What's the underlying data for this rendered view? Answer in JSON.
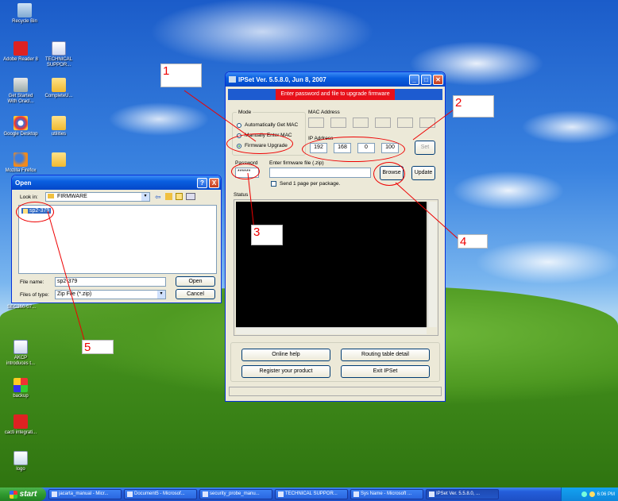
{
  "desktop_icons": [
    {
      "id": "recycle",
      "label": "Recycle Bin",
      "icon": "recycle-bin-icon"
    },
    {
      "id": "adobe",
      "label": "Adobe Reader 8",
      "icon": "pdf-icon"
    },
    {
      "id": "technical",
      "label": "TECHNICAL SUPPOR...",
      "icon": "word-doc-icon"
    },
    {
      "id": "oracle",
      "label": "Get Started With Oracl...",
      "icon": "database-icon"
    },
    {
      "id": "complete",
      "label": "CompleteU...",
      "icon": "folder-icon"
    },
    {
      "id": "google",
      "label": "Google Desktop",
      "icon": "google-desktop-icon"
    },
    {
      "id": "utilities",
      "label": "utilities",
      "icon": "folder-icon"
    },
    {
      "id": "firefox",
      "label": "Mozilla Firefox",
      "icon": "firefox-icon"
    },
    {
      "id": "folder2",
      "label": "",
      "icon": "folder-icon"
    },
    {
      "id": "sec",
      "label": "SEC360-07...",
      "icon": "folder-icon"
    },
    {
      "id": "akcp",
      "label": "AKCP introduces t...",
      "icon": "word-doc-icon"
    },
    {
      "id": "backup",
      "label": "backup",
      "icon": "backup-icon"
    },
    {
      "id": "cacti",
      "label": "cacti integrati...",
      "icon": "pdf-icon"
    },
    {
      "id": "logo",
      "label": "logo",
      "icon": "image-icon"
    }
  ],
  "callouts": [
    "1",
    "2",
    "3",
    "4",
    "5"
  ],
  "open_dialog": {
    "title": "Open",
    "look_in_label": "Look in:",
    "look_in_value": "FIRMWARE",
    "files": [
      "sp2-379"
    ],
    "file_name_label": "File name:",
    "file_name_value": "sp2-379",
    "files_of_type_label": "Files of type:",
    "files_of_type_value": "Zip File (*.zip)",
    "open_button": "Open",
    "cancel_button": "Cancel",
    "help_button": "?",
    "close_button": "X"
  },
  "ipset": {
    "title": "IPSet  Ver. 5.5.8.0,  Jun 8, 2007",
    "banner": "Enter password and file to upgrade firmware",
    "mode_label": "Mode",
    "mode_options": [
      "Automatically Get MAC",
      "Manually Enter MAC",
      "Firmware Upgrade"
    ],
    "mode_selected": "Firmware Upgrade",
    "mac_label": "MAC Address",
    "ip_label": "IP Address",
    "ip_octets": [
      "192",
      "168",
      "0",
      "100"
    ],
    "set_button": "Set",
    "password_label": "Password",
    "password_value": "******",
    "firmware_label": "Enter firmware file (.zip)",
    "firmware_value": "",
    "browse_button": "Browse",
    "update_button": "Update",
    "send_one_label": "Send 1 page per package.",
    "status_label": "Status",
    "online_help": "Online help",
    "routing_table": "Routing table detail",
    "register": "Register your product",
    "exit": "Exit IPSet"
  },
  "taskbar": {
    "start": "start",
    "tasks": [
      "jacarta_manual - Micr...",
      "Document5 - Microsof...",
      "security_probe_manu...",
      "TECHNICAL SUPPOR...",
      "Sys Name - Microsoft ...",
      "IPSet  Ver. 5.5.8.0, ..."
    ],
    "active_task": "IPSet  Ver. 5.5.8.0, ...",
    "clock": "6:06 PM"
  },
  "colors": {
    "banner_red": "#e8101a",
    "banner_blue": "#1d5bd0",
    "annotation_red": "#e00000",
    "status_black": "#000000"
  }
}
